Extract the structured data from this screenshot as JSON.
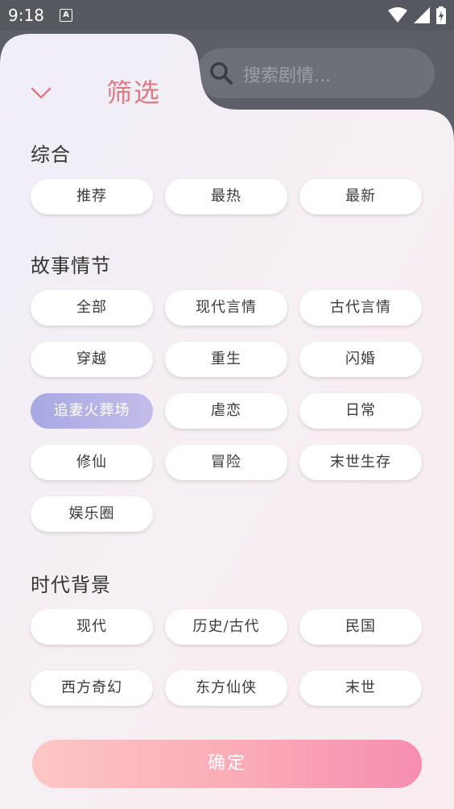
{
  "status_bar": {
    "time": "9:18",
    "notification_badge": "A"
  },
  "search": {
    "placeholder": "搜索剧情..."
  },
  "sheet": {
    "title": "筛选",
    "confirm_label": "确定"
  },
  "sections": [
    {
      "title": "综合",
      "chips": [
        "推荐",
        "最热",
        "最新"
      ],
      "selected": null
    },
    {
      "title": "故事情节",
      "chips": [
        "全部",
        "现代言情",
        "古代言情",
        "穿越",
        "重生",
        "闪婚",
        "追妻火葬场",
        "虐恋",
        "日常",
        "修仙",
        "冒险",
        "末世生存",
        "娱乐圈"
      ],
      "selected": "追妻火葬场"
    },
    {
      "title": "时代背景",
      "chips": [
        "现代",
        "历史/古代",
        "民国",
        "西方奇幻",
        "东方仙侠",
        "末世"
      ],
      "selected": null
    }
  ],
  "colors": {
    "accent": "#e07a82",
    "selected_chip": "#a7a8e4",
    "confirm_start": "#fdc7c4",
    "confirm_end": "#f68eb0"
  },
  "icons": [
    "search-icon",
    "chevron-down-icon",
    "wifi-icon",
    "signal-icon",
    "battery-icon"
  ]
}
